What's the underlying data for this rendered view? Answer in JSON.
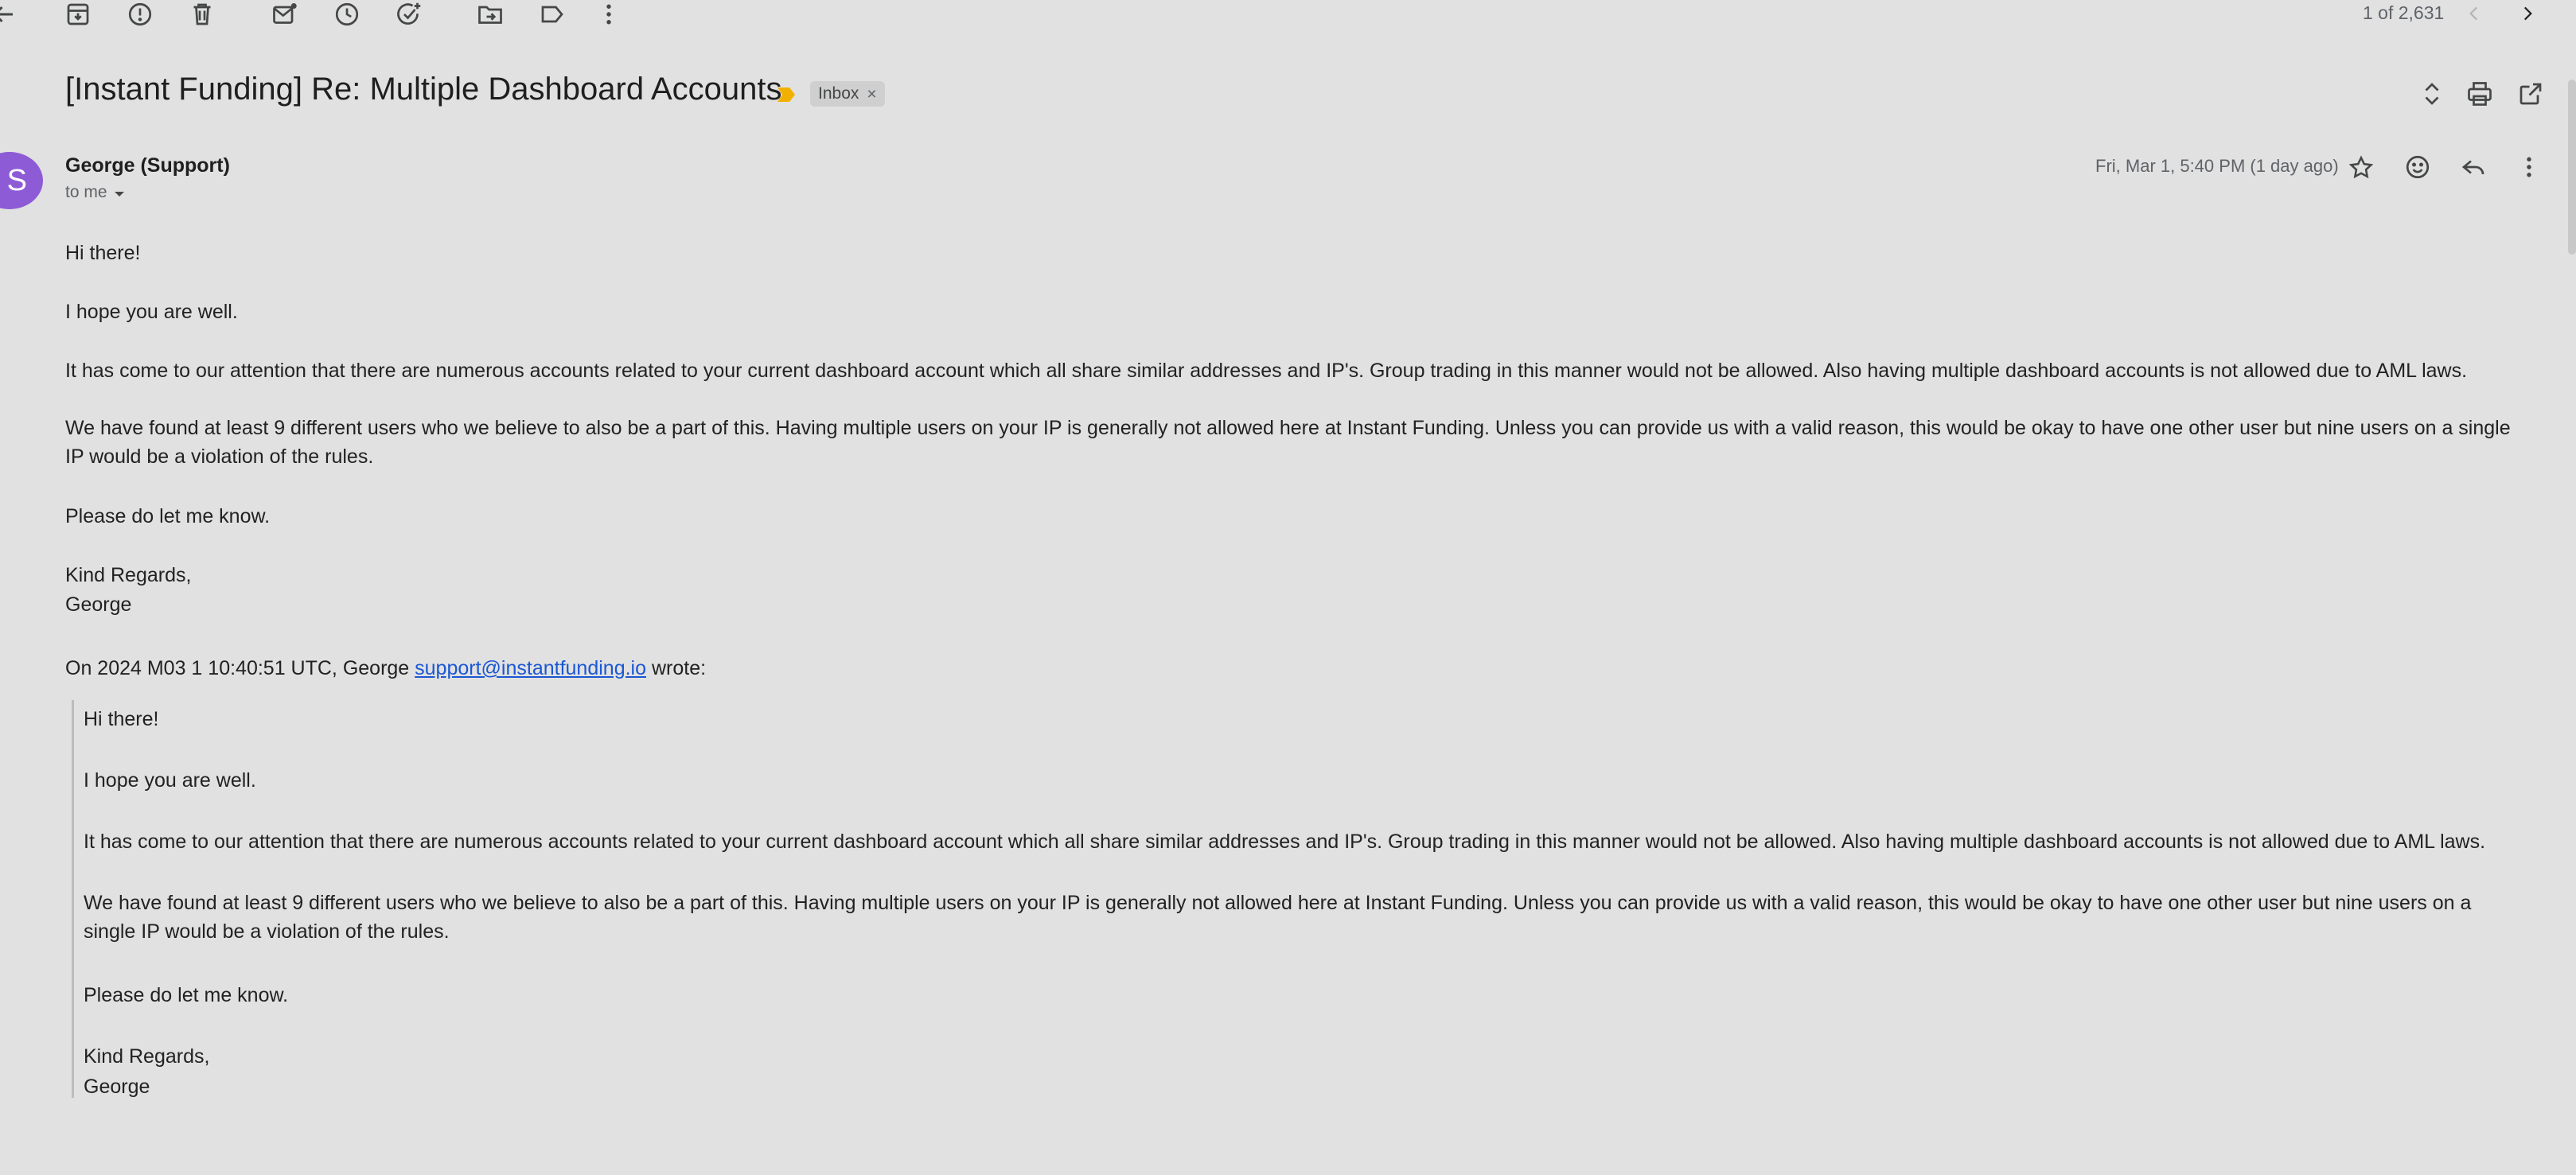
{
  "toolbar": {
    "icons": [
      "back-arrow-icon",
      "archive-icon",
      "report-spam-icon",
      "delete-icon",
      "mark-unread-icon",
      "snooze-icon",
      "add-to-tasks-icon",
      "move-to-icon",
      "label-icon",
      "more-vert-icon"
    ],
    "counter": "1 of 2,631"
  },
  "message": {
    "subject": "[Instant Funding] Re: Multiple Dashboard Accounts",
    "label": "Inbox",
    "label_remove": "×",
    "avatar_letter": "S",
    "sender": "George (Support)",
    "to": "to me",
    "date": "Fri, Mar 1, 5:40 PM (1 day ago)",
    "accent_color": "#8e5bd6"
  },
  "body": {
    "greeting": "Hi there!",
    "hope": "I hope you are well.",
    "p1": "It has come to our attention that there are numerous accounts related to your current dashboard account which all share similar addresses and IP's. Group trading in this manner would not be allowed. Also having multiple dashboard accounts is not allowed due to AML laws.",
    "p2": "We have found at least 9 different users who we believe to also be a part of this. Having multiple users on your IP is generally not allowed here at Instant Funding. Unless you can provide us with a valid reason, this would be okay to have one other user but nine users on a single IP would be a violation of the rules.",
    "p3": "Please do let me know.",
    "signoff": "Kind Regards,",
    "signature": "George"
  },
  "quote": {
    "intro_prefix": "On 2024 M03 1 10:40:51 UTC, George ",
    "email": "support@instantfunding.io",
    "intro_suffix": " wrote:",
    "greeting": "Hi there!",
    "hope": "I hope you are well.",
    "p1": "It has come to our attention that there are numerous accounts related to your current dashboard account which all share similar addresses and IP's. Group trading in this manner would not be allowed. Also having multiple dashboard accounts is not allowed due to AML laws.",
    "p2": "We have found at least 9 different users who we believe to also be a part of this. Having multiple users on your IP is generally not allowed here at Instant Funding. Unless you can provide us with a valid reason, this would be okay to have one other user but nine users on a single IP would be a violation of the rules.",
    "p3": "Please do let me know.",
    "signoff": "Kind Regards,",
    "signature": "George"
  }
}
